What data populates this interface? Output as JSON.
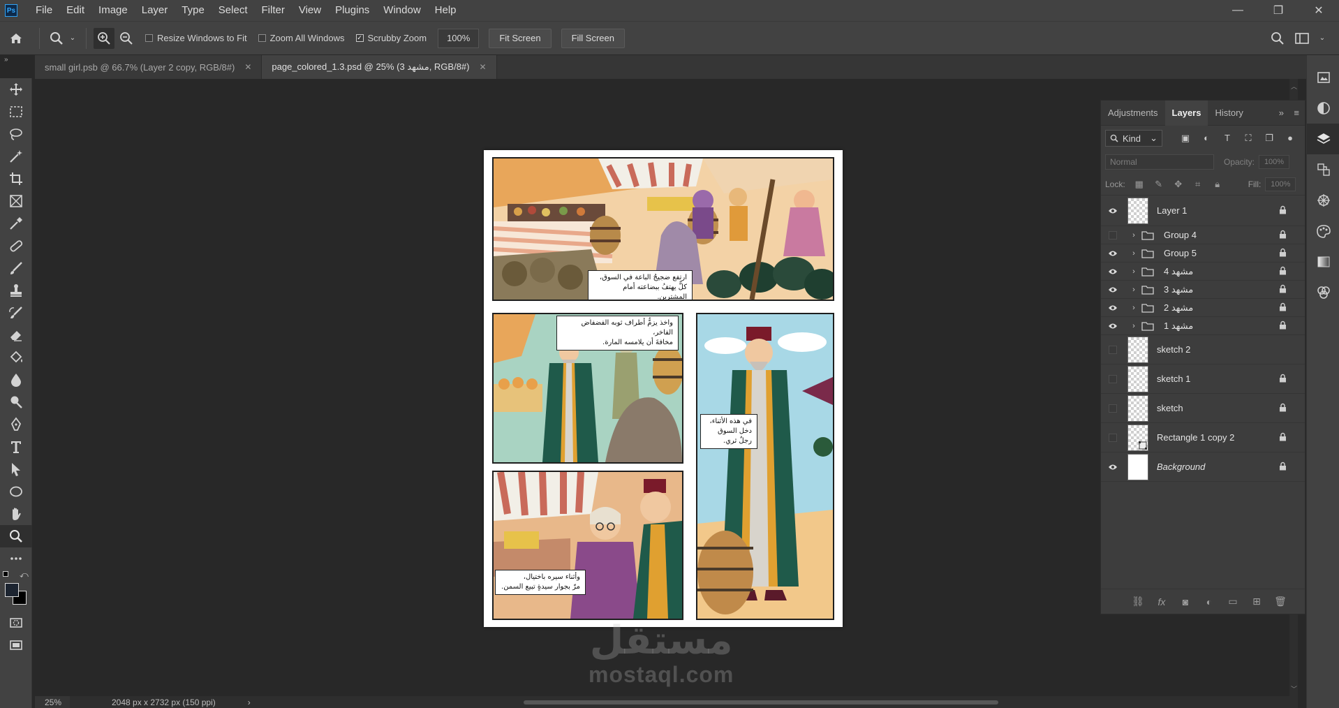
{
  "menubar": {
    "logo": "Ps",
    "items": [
      "File",
      "Edit",
      "Image",
      "Layer",
      "Type",
      "Select",
      "Filter",
      "View",
      "Plugins",
      "Window",
      "Help"
    ],
    "window_controls": {
      "minimize": "—",
      "restore": "❐",
      "close": "✕"
    }
  },
  "options": {
    "resize_windows": "Resize Windows to Fit",
    "zoom_all": "Zoom All Windows",
    "scrubby_zoom": "Scrubby Zoom",
    "scrubby_check": "✓",
    "zoom_value": "100%",
    "fit_screen": "Fit Screen",
    "fill_screen": "Fill Screen",
    "collapse": "»"
  },
  "tabs": [
    {
      "label": "small girl.psb @ 66.7% (Layer 2 copy, RGB/8#)",
      "close": "✕"
    },
    {
      "label": "page_colored_1.3.psd @ 25% (مشهد 3, RGB/8#)",
      "close": "✕"
    }
  ],
  "captions": {
    "c1": "ارتفع ضجيجُ الباعة في السوق،\nكلٌّ يهتفُ ببضاعته أمام المشترين.",
    "c2": "واخذ يزمُّ أطراف ثوبه الفضفاض الفاخر،\nمخافةَ أن يلامسه المارة.",
    "c3": "في هذه الأثناء،\nدخل السوق رجلٌ ثري.",
    "c4": "وأثناء سيره باختيال،\nمرّ بجوار سيدةٍ تبيع السمن."
  },
  "watermark": {
    "arabic": "مستقل",
    "latin": "mostaql.com"
  },
  "status": {
    "zoom": "25%",
    "dims": "2048 px x 2732 px (150 ppi)",
    "arrow": "›"
  },
  "panel": {
    "tabs": [
      "Adjustments",
      "Layers",
      "History"
    ],
    "collapse": "»",
    "menu": "≡",
    "kind": "Kind",
    "kind_arrow": "⌄",
    "blend_mode": "Normal",
    "opacity_label": "Opacity:",
    "opacity_value": "100%",
    "lock_label": "Lock:",
    "fill_label": "Fill:",
    "fill_value": "100%",
    "layers": [
      {
        "name": "Layer 1",
        "visible": true,
        "type": "pixel",
        "locked": true
      },
      {
        "name": "Group 4",
        "visible": false,
        "type": "group",
        "locked": true
      },
      {
        "name": "Group 5",
        "visible": true,
        "type": "group",
        "locked": true
      },
      {
        "name": "مشهد 4",
        "visible": true,
        "type": "group",
        "locked": true
      },
      {
        "name": "مشهد 3",
        "visible": true,
        "type": "group",
        "locked": true
      },
      {
        "name": "مشهد 2",
        "visible": true,
        "type": "group",
        "locked": true
      },
      {
        "name": "مشهد 1",
        "visible": true,
        "type": "group",
        "locked": true
      },
      {
        "name": "sketch 2",
        "visible": false,
        "type": "pixel",
        "locked": false
      },
      {
        "name": "sketch 1",
        "visible": false,
        "type": "pixel",
        "locked": true
      },
      {
        "name": "sketch",
        "visible": false,
        "type": "pixel",
        "locked": true
      },
      {
        "name": "Rectangle 1 copy 2",
        "visible": false,
        "type": "shape",
        "locked": true
      },
      {
        "name": "Background",
        "visible": true,
        "type": "background",
        "locked": true
      }
    ]
  },
  "colors": {
    "accent": "#31a8ff",
    "foreground": "#1c2430",
    "background": "#000000"
  }
}
